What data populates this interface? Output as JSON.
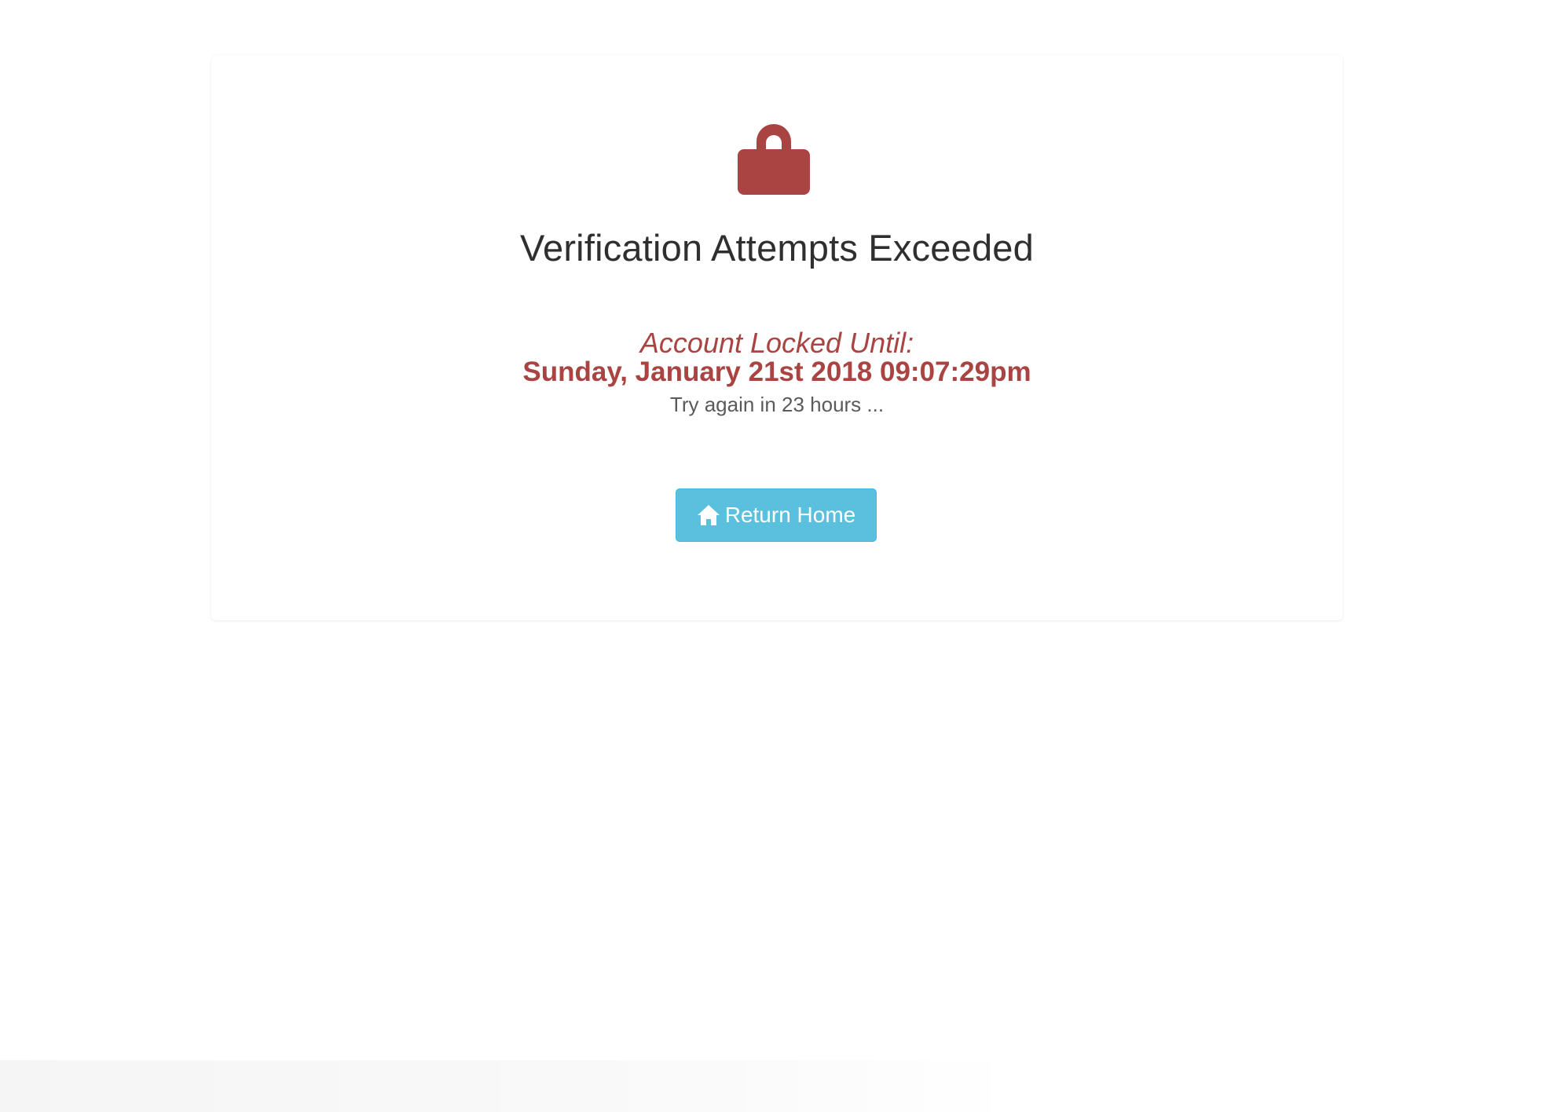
{
  "lock_screen": {
    "icon": "lock-icon",
    "title": "Verification Attempts Exceeded",
    "locked_label": "Account Locked Until:",
    "locked_until": "Sunday, January 21st 2018 09:07:29pm",
    "retry_message": "Try again in 23 hours ..."
  },
  "actions": {
    "return_home_label": "Return Home",
    "return_home_icon": "home-icon"
  },
  "colors": {
    "danger": "#a94442",
    "info_button": "#5bc0de",
    "title_text": "#2f2f2f",
    "muted_text": "#5a5a5a"
  }
}
